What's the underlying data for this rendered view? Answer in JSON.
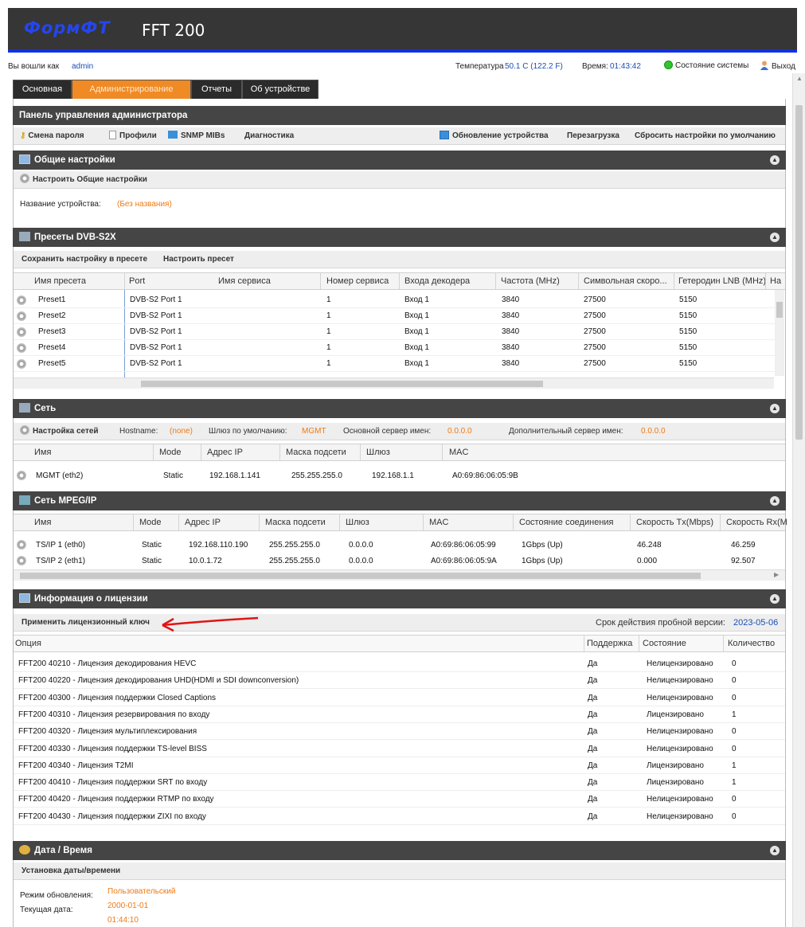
{
  "header": {
    "logo": "ФормФТ",
    "model": "FFT 200"
  },
  "userbar": {
    "logged_in_label": "Вы вошли как",
    "user": "admin",
    "temp_label": "Температура",
    "temp_value": "50.1 C (122.2 F)",
    "time_label": "Время:",
    "time_value": "01:43:42",
    "system_state": "Состояние системы",
    "logout": "Выход"
  },
  "tabs": [
    "Основная",
    "Администрирование",
    "Отчеты",
    "Об устройстве"
  ],
  "admin_panel": {
    "title": "Панель управления администратора",
    "change_password": "Смена пароля",
    "profiles": "Профили",
    "snmp_mibs": "SNMP MIBs",
    "diagnostics": "Диагностика",
    "device_update": "Обновление устройства",
    "reboot": "Перезагрузка",
    "reset_defaults": "Сбросить настройки по умолчанию"
  },
  "general": {
    "title": "Общие настройки",
    "configure": "Настроить Общие настройки",
    "device_name_label": "Название устройства:",
    "device_name_value": "(Без названия)"
  },
  "presets": {
    "title": "Пресеты DVB-S2X",
    "save_preset": "Сохранить настройку в пресете",
    "configure_preset": "Настроить пресет",
    "columns": [
      "Имя пресета",
      "Port",
      "Имя сервиса",
      "Номер сервиса",
      "Входа декодера",
      "Частота (MHz)",
      "Символьная скоро...",
      "Гетеродин LNB (MHz)",
      "На"
    ],
    "rows": [
      [
        "Preset1",
        "DVB-S2 Port 1",
        "",
        "1",
        "Вход 1",
        "3840",
        "27500",
        "5150"
      ],
      [
        "Preset2",
        "DVB-S2 Port 1",
        "",
        "1",
        "Вход 1",
        "3840",
        "27500",
        "5150"
      ],
      [
        "Preset3",
        "DVB-S2 Port 1",
        "",
        "1",
        "Вход 1",
        "3840",
        "27500",
        "5150"
      ],
      [
        "Preset4",
        "DVB-S2 Port 1",
        "",
        "1",
        "Вход 1",
        "3840",
        "27500",
        "5150"
      ],
      [
        "Preset5",
        "DVB-S2 Port 1",
        "",
        "1",
        "Вход 1",
        "3840",
        "27500",
        "5150"
      ]
    ]
  },
  "network": {
    "title": "Сеть",
    "configure": "Настройка сетей",
    "hostname_label": "Hostname:",
    "hostname_value": "(none)",
    "gateway_label": "Шлюз по умолчанию:",
    "gateway_value": "MGMT",
    "dns1_label": "Основной сервер имен:",
    "dns1_value": "0.0.0.0",
    "dns2_label": "Дополнительный сервер имен:",
    "dns2_value": "0.0.0.0",
    "columns": [
      "Имя",
      "Mode",
      "Адрес IP",
      "Маска подсети",
      "Шлюз",
      "MAC"
    ],
    "rows": [
      [
        "MGMT (eth2)",
        "Static",
        "192.168.1.141",
        "255.255.255.0",
        "192.168.1.1",
        "A0:69:86:06:05:9B"
      ]
    ]
  },
  "mpeg": {
    "title": "Сеть MPEG/IP",
    "columns": [
      "Имя",
      "Mode",
      "Адрес IP",
      "Маска подсети",
      "Шлюз",
      "MAC",
      "Состояние соединения",
      "Скорость Tx(Mbps)",
      "Скорость Rx(M"
    ],
    "rows": [
      [
        "TS/IP 1 (eth0)",
        "Static",
        "192.168.110.190",
        "255.255.255.0",
        "0.0.0.0",
        "A0:69:86:06:05:99",
        "1Gbps (Up)",
        "46.248",
        "46.259"
      ],
      [
        "TS/IP 2 (eth1)",
        "Static",
        "10.0.1.72",
        "255.255.255.0",
        "0.0.0.0",
        "A0:69:86:06:05:9A",
        "1Gbps (Up)",
        "0.000",
        "92.507"
      ]
    ]
  },
  "license": {
    "title": "Информация о лицензии",
    "apply_key": "Применить лицензионный ключ",
    "trial_label": "Срок действия пробной версии:",
    "trial_value": "2023-05-06",
    "columns": [
      "Опция",
      "Поддержка",
      "Состояние",
      "Количество"
    ],
    "rows": [
      [
        "FFT200 40210 - Лицензия декодирования HEVC",
        "Да",
        "Нелицензировано",
        "0"
      ],
      [
        "FFT200 40220 - Лицензия декодирования UHD(HDMI и SDI downconversion)",
        "Да",
        "Нелицензировано",
        "0"
      ],
      [
        "FFT200 40300 - Лицензия поддержки Closed Captions",
        "Да",
        "Нелицензировано",
        "0"
      ],
      [
        "FFT200 40310 - Лицензия резервирования по входу",
        "Да",
        "Лицензировано",
        "1"
      ],
      [
        "FFT200 40320 - Лицензия мультиплексирования",
        "Да",
        "Нелицензировано",
        "0"
      ],
      [
        "FFT200 40330 - Лицензия поддержки TS-level BISS",
        "Да",
        "Нелицензировано",
        "0"
      ],
      [
        "FFT200 40340 - Лицензия T2MI",
        "Да",
        "Лицензировано",
        "1"
      ],
      [
        "FFT200 40410 - Лицензия поддержки SRT по входу",
        "Да",
        "Лицензировано",
        "1"
      ],
      [
        "FFT200 40420 - Лицензия поддержки RTMP по входу",
        "Да",
        "Нелицензировано",
        "0"
      ],
      [
        "FFT200 40430 - Лицензия поддержки ZIXI по входу",
        "Да",
        "Нелицензировано",
        "0"
      ]
    ]
  },
  "datetime": {
    "title": "Дата / Время",
    "set": "Установка даты/времени",
    "mode_label": "Режим обновления:",
    "mode_value": "Пользовательский",
    "date_label": "Текущая дата:",
    "date_value": "2000-01-01",
    "time_value": "01:44:10"
  },
  "colors": {
    "accent": "#f08a24",
    "header_bg": "#363636",
    "link": "#1a4fb5",
    "brand_blue": "#1030e8"
  }
}
